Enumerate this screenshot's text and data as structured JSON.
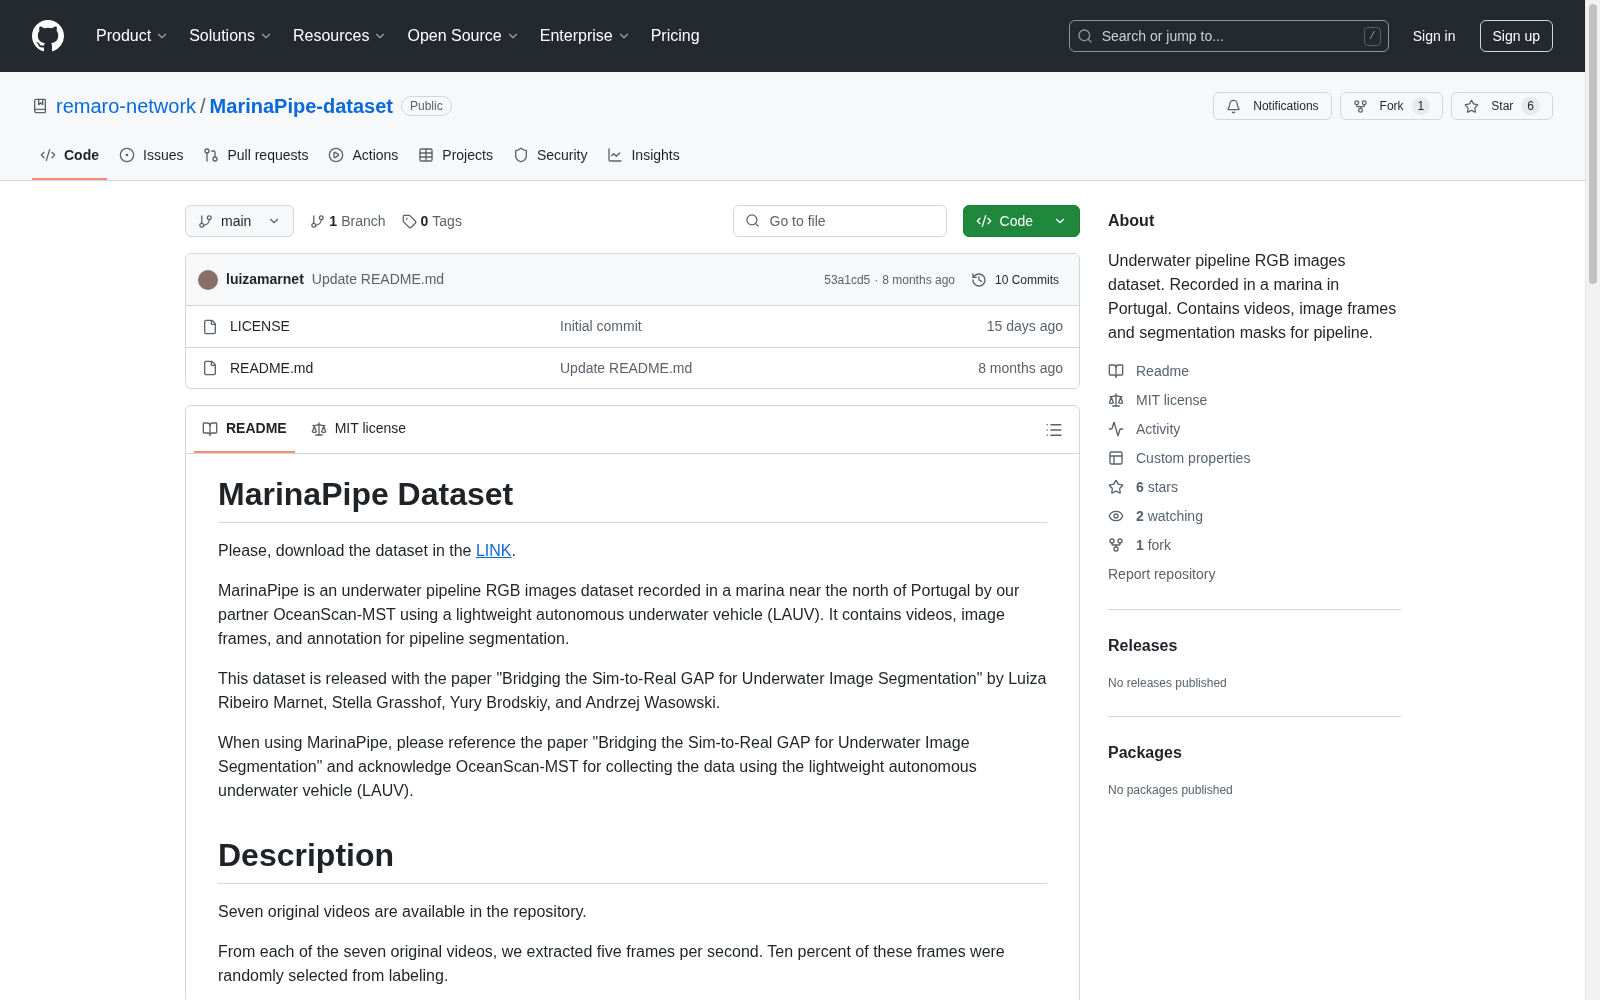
{
  "header": {
    "nav": [
      {
        "label": "Product",
        "dropdown": true
      },
      {
        "label": "Solutions",
        "dropdown": true
      },
      {
        "label": "Resources",
        "dropdown": true
      },
      {
        "label": "Open Source",
        "dropdown": true
      },
      {
        "label": "Enterprise",
        "dropdown": true
      },
      {
        "label": "Pricing",
        "dropdown": false
      }
    ],
    "search": {
      "placeholder": "Search or jump to...",
      "shortcut": "/"
    },
    "sign_in": "Sign in",
    "sign_up": "Sign up"
  },
  "repo": {
    "owner": "remaro-network",
    "separator": "/",
    "name": "MarinaPipe-dataset",
    "visibility": "Public",
    "actions": [
      {
        "kind": "notifications",
        "label": "Notifications"
      },
      {
        "kind": "fork",
        "label": "Fork",
        "count": "1"
      },
      {
        "kind": "star",
        "label": "Star",
        "count": "6"
      }
    ]
  },
  "tabs": [
    {
      "kind": "code",
      "label": "Code",
      "selected": true
    },
    {
      "kind": "issues",
      "label": "Issues",
      "selected": false
    },
    {
      "kind": "pulls",
      "label": "Pull requests",
      "selected": false
    },
    {
      "kind": "actions",
      "label": "Actions",
      "selected": false
    },
    {
      "kind": "projects",
      "label": "Projects",
      "selected": false
    },
    {
      "kind": "security",
      "label": "Security",
      "selected": false
    },
    {
      "kind": "insights",
      "label": "Insights",
      "selected": false
    }
  ],
  "toolbar": {
    "branch": "main",
    "branches_count": "1",
    "branches_label": "Branch",
    "tags_count": "0",
    "tags_label": "Tags",
    "go_to_file": {
      "placeholder": "Go to file"
    },
    "code_button": "Code"
  },
  "latest_commit": {
    "author": "luizamarnet",
    "message": "Update README.md",
    "hash": "53a1cd5",
    "separator": "·",
    "time": "8 months ago",
    "commits": "10 Commits"
  },
  "files": [
    {
      "name": "LICENSE",
      "message": "Initial commit",
      "time": "15 days ago"
    },
    {
      "name": "README.md",
      "message": "Update README.md",
      "time": "8 months ago"
    }
  ],
  "readme_tabs": [
    {
      "kind": "readme",
      "label": "README",
      "selected": true
    },
    {
      "kind": "license",
      "label": "MIT license",
      "selected": false
    }
  ],
  "readme": {
    "title": "MarinaPipe Dataset",
    "download": {
      "before": "Please, download the dataset in the ",
      "link": "LINK",
      "after": "."
    },
    "paragraphs": [
      "MarinaPipe is an underwater pipeline RGB images dataset recorded in a marina near the north of Portugal by our partner OceanScan-MST using a lightweight autonomous underwater vehicle (LAUV). It contains videos, image frames, and annotation for pipeline segmentation.",
      "This dataset is released with the paper \"Bridging the Sim-to-Real GAP for Underwater Image Segmentation\" by Luiza Ribeiro Marnet, Stella Grasshof, Yury Brodskiy, and Andrzej Wasowski.",
      "When using MarinaPipe, please reference the paper \"Bridging the Sim-to-Real GAP for Underwater Image Segmentation\" and acknowledge OceanScan-MST for collecting the data using the lightweight autonomous underwater vehicle (LAUV)."
    ],
    "section_title": "Description",
    "section_paragraphs": [
      "Seven original videos are available in the repository.",
      "From each of the seven original videos, we extracted five frames per second. Ten percent of these frames were randomly selected from labeling."
    ]
  },
  "about": {
    "title": "About",
    "description": "Underwater pipeline RGB images dataset. Recorded in a marina in Portugal. Contains videos, image frames and segmentation masks for pipeline.",
    "links": [
      {
        "kind": "readme",
        "label": "Readme"
      },
      {
        "kind": "license",
        "label": "MIT license"
      },
      {
        "kind": "activity",
        "label": "Activity"
      },
      {
        "kind": "properties",
        "label": "Custom properties"
      },
      {
        "kind": "stars",
        "count": "6",
        "label": "stars"
      },
      {
        "kind": "watching",
        "count": "2",
        "label": "watching"
      },
      {
        "kind": "fork",
        "count": "1",
        "label": "fork"
      }
    ],
    "report": "Report repository"
  },
  "releases": {
    "title": "Releases",
    "empty": "No releases published"
  },
  "packages": {
    "title": "Packages",
    "empty": "No packages published"
  }
}
